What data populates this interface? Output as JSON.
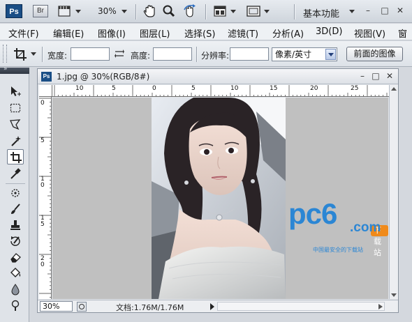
{
  "appbar": {
    "logo": "Ps",
    "bridge": "Br",
    "zoom": "30%",
    "workspace": "基本功能",
    "icons": [
      "screen-mode-icon",
      "hand-tool-icon",
      "zoom-tool-icon",
      "rotate-view-icon",
      "arrange-documents-icon",
      "view-mode-icon"
    ]
  },
  "menu": [
    "文件(F)",
    "编辑(E)",
    "图像(I)",
    "图层(L)",
    "选择(S)",
    "滤镜(T)",
    "分析(A)",
    "3D(D)",
    "视图(V)",
    "窗"
  ],
  "options": {
    "width_label": "宽度:",
    "width_value": "",
    "height_label": "高度:",
    "height_value": "",
    "resolution_label": "分辨率:",
    "resolution_value": "",
    "unit": "像素/英寸",
    "front_image_btn": "前面的图像"
  },
  "tools": [
    "move",
    "marquee",
    "lasso",
    "magic-wand",
    "crop",
    "eyedropper",
    "spot-healing",
    "brush",
    "clone-stamp",
    "history-brush",
    "eraser",
    "paint-bucket",
    "blur",
    "dodge"
  ],
  "document": {
    "title": "1.jpg @ 30%(RGB/8#)",
    "ruler_top": [
      "10",
      "5",
      "0",
      "5",
      "10",
      "15",
      "20",
      "25"
    ],
    "ruler_left": [
      "0",
      "5",
      "1 0",
      "1 5",
      "2 0"
    ],
    "zoom": "30%",
    "info": "文档:1.76M/1.76M"
  },
  "watermark": {
    "brand": "pc6",
    "dotcom": ".com",
    "badge": "下载站",
    "tagline": "中国最安全的下载站"
  },
  "colors": {
    "brand_blue": "#2b86d4",
    "badge_orange": "#f08a1a",
    "canvas_gray": "#c0c0c0"
  }
}
